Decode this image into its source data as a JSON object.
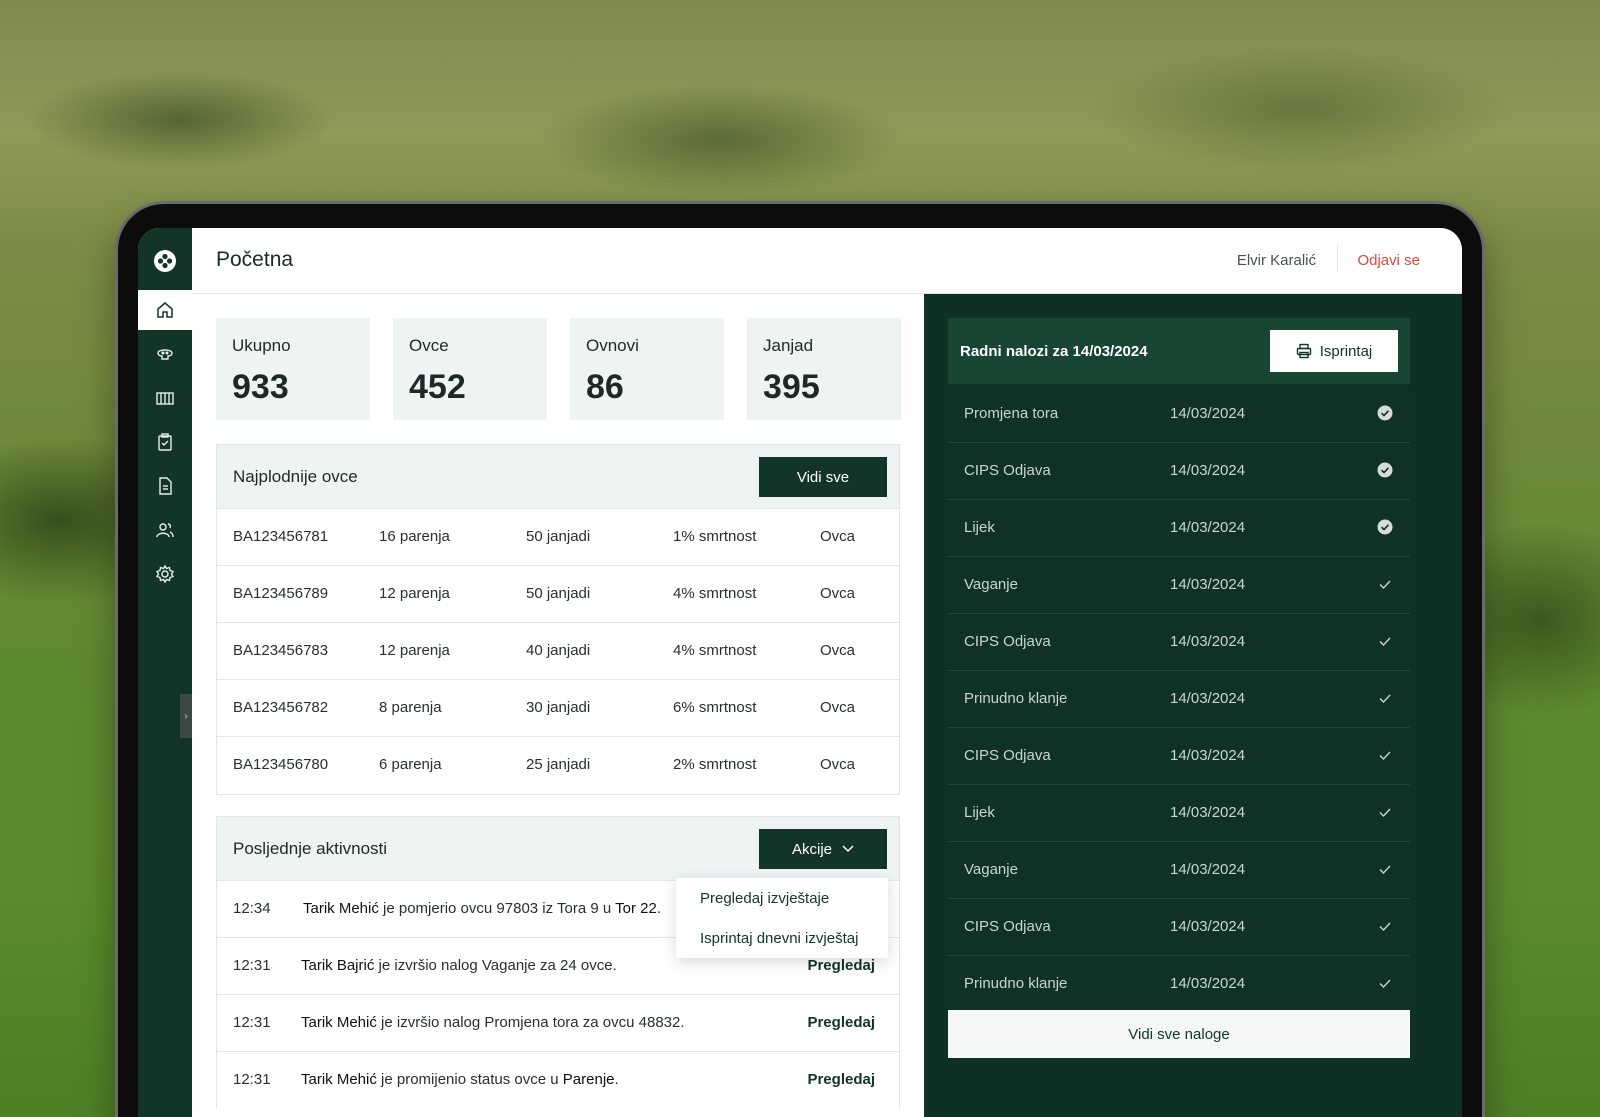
{
  "header": {
    "title": "Početna",
    "user_name": "Elvir Karalić",
    "logout_label": "Odjavi se"
  },
  "sidebar": {
    "items": [
      {
        "icon": "home-icon",
        "active": true
      },
      {
        "icon": "sheep-icon",
        "active": false
      },
      {
        "icon": "fence-icon",
        "active": false
      },
      {
        "icon": "clipboard-icon",
        "active": false
      },
      {
        "icon": "document-icon",
        "active": false
      },
      {
        "icon": "users-icon",
        "active": false
      },
      {
        "icon": "gear-icon",
        "active": false
      }
    ],
    "toggle_glyph": "›"
  },
  "stats": [
    {
      "label": "Ukupno",
      "value": "933"
    },
    {
      "label": "Ovce",
      "value": "452"
    },
    {
      "label": "Ovnovi",
      "value": "86"
    },
    {
      "label": "Janjad",
      "value": "395"
    }
  ],
  "fertile": {
    "title": "Najplodnije ovce",
    "button_label": "Vidi sve",
    "rows": [
      [
        "BA123456781",
        "16 parenja",
        "50 janjadi",
        "1% smrtnost",
        "Ovca"
      ],
      [
        "BA123456789",
        "12 parenja",
        "50 janjadi",
        "4% smrtnost",
        "Ovca"
      ],
      [
        "BA123456783",
        "12 parenja",
        "40 janjadi",
        "4% smrtnost",
        "Ovca"
      ],
      [
        "BA123456782",
        "8 parenja",
        "30 janjadi",
        "6% smrtnost",
        "Ovca"
      ],
      [
        "BA123456780",
        "6 parenja",
        "25 janjadi",
        "2% smrtnost",
        "Ovca"
      ]
    ]
  },
  "activities": {
    "title": "Posljednje aktivnosti",
    "button_label": "Akcije",
    "rows": [
      {
        "time": "12:34",
        "actor": "Tarik Mehić",
        "text": " je pomjerio ovcu 97803 iz Tora 9 u ",
        "strong_end": "Tor 22",
        "tail": ".",
        "link": ""
      },
      {
        "time": "12:31",
        "actor": "Tarik Bajrić",
        "text": " je izvršio nalog Vaganje za 24 ovce.",
        "strong_end": "",
        "tail": "",
        "link": "Pregledaj"
      },
      {
        "time": "12:31",
        "actor": "Tarik Mehić",
        "text": " je izvršio nalog Promjena tora za ovcu 48832.",
        "strong_end": "",
        "tail": "",
        "link": "Pregledaj"
      },
      {
        "time": "12:31",
        "actor": "Tarik Mehić",
        "text": " je promijenio status ovce u ",
        "strong_end": "Parenje",
        "tail": ".",
        "link": "Pregledaj"
      }
    ],
    "menu": [
      "Pregledaj izvještaje",
      "Isprintaj dnevni izvještaj"
    ]
  },
  "orders": {
    "title": "Radni nalozi za 14/03/2024",
    "print_label": "Isprintaj",
    "all_label": "Vidi sve naloge",
    "rows": [
      {
        "name": "Promjena tora",
        "date": "14/03/2024",
        "status": "done"
      },
      {
        "name": "CIPS Odjava",
        "date": "14/03/2024",
        "status": "done"
      },
      {
        "name": "Lijek",
        "date": "14/03/2024",
        "status": "done"
      },
      {
        "name": "Vaganje",
        "date": "14/03/2024",
        "status": "pending"
      },
      {
        "name": "CIPS Odjava",
        "date": "14/03/2024",
        "status": "pending"
      },
      {
        "name": "Prinudno klanje",
        "date": "14/03/2024",
        "status": "pending"
      },
      {
        "name": "CIPS Odjava",
        "date": "14/03/2024",
        "status": "pending"
      },
      {
        "name": "Lijek",
        "date": "14/03/2024",
        "status": "pending"
      },
      {
        "name": "Vaganje",
        "date": "14/03/2024",
        "status": "pending"
      },
      {
        "name": "CIPS Odjava",
        "date": "14/03/2024",
        "status": "pending"
      },
      {
        "name": "Prinudno klanje",
        "date": "14/03/2024",
        "status": "pending"
      }
    ]
  },
  "colors": {
    "brand_dark": "#123528",
    "panel_dark": "#0e3025",
    "accent_red": "#e2463a",
    "stat_bg": "#eef3f4"
  }
}
